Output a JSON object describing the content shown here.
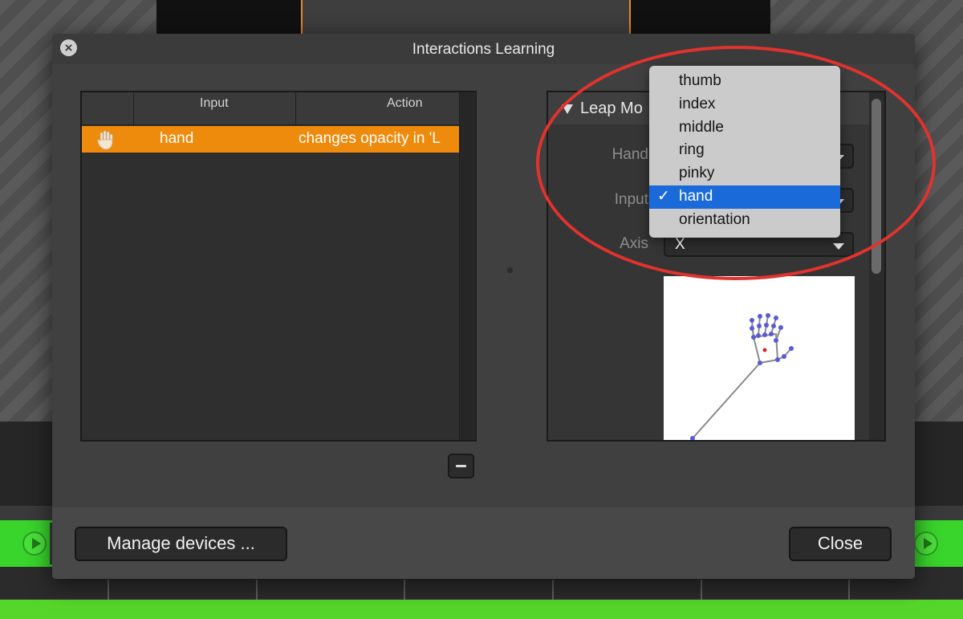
{
  "dialog": {
    "title": "Interactions Learning"
  },
  "table": {
    "columns": [
      "Input",
      "Action"
    ],
    "rows": [
      {
        "input": "hand",
        "action": "changes opacity in 'L",
        "icon": "hand-icon",
        "selected": true
      }
    ]
  },
  "device_panel": {
    "title": "Leap Mo",
    "hand_label": "Hand",
    "input_label": "Input",
    "axis_label": "Axis",
    "axis_value": "X"
  },
  "input_menu": {
    "items": [
      "thumb",
      "index",
      "middle",
      "ring",
      "pinky",
      "hand",
      "orientation"
    ],
    "selected": "hand",
    "check_mark": "✓"
  },
  "footer": {
    "manage_devices_label": "Manage devices ...",
    "close_label": "Close"
  },
  "colors": {
    "selection_orange": "#ef8b0c",
    "menu_highlight": "#1a6ad9",
    "annotation_red": "#e0332e",
    "timeline_green": "#39d42c"
  }
}
